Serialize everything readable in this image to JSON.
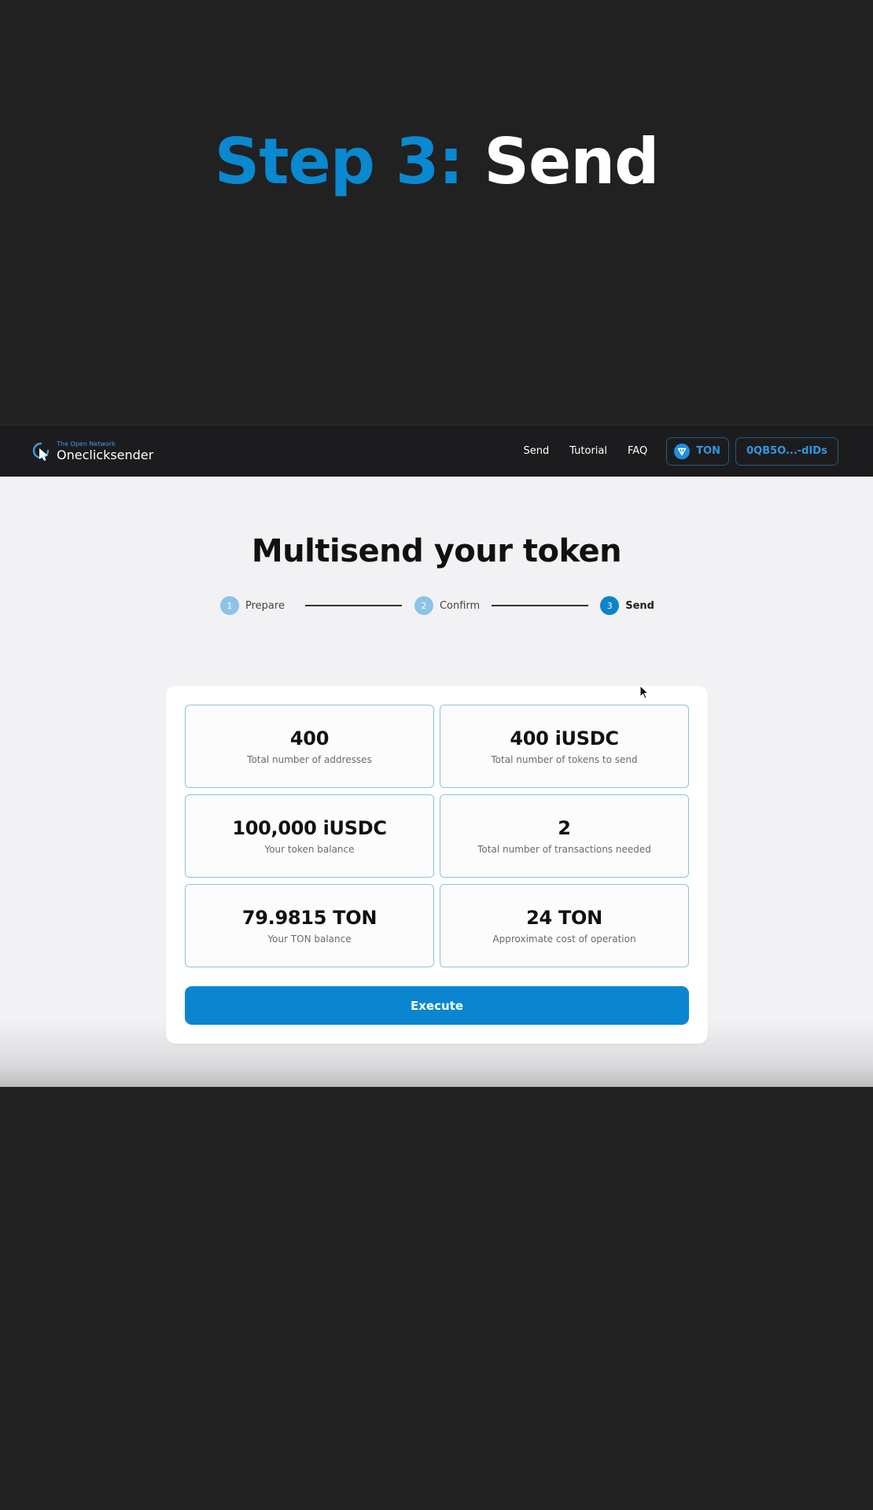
{
  "banner": {
    "step_prefix": "Step 3:",
    "step_name": "Send"
  },
  "navbar": {
    "logo_subtitle": "The Open Network",
    "logo_name": "Oneclicksender",
    "links": [
      "Send",
      "Tutorial",
      "FAQ"
    ],
    "network_label": "TON",
    "wallet_address": "0QB5O...-dIDs"
  },
  "page": {
    "title": "Multisend your token"
  },
  "stepper": {
    "steps": [
      {
        "number": "1",
        "label": "Prepare"
      },
      {
        "number": "2",
        "label": "Confirm"
      },
      {
        "number": "3",
        "label": "Send"
      }
    ],
    "active_step": 3
  },
  "stats": [
    {
      "value": "400",
      "label": "Total number of addresses"
    },
    {
      "value": "400 iUSDC",
      "label": "Total number of tokens to send"
    },
    {
      "value": "100,000 iUSDC",
      "label": "Your token balance"
    },
    {
      "value": "2",
      "label": "Total number of transactions needed"
    },
    {
      "value": "79.9815 TON",
      "label": "Your TON balance"
    },
    {
      "value": "24 TON",
      "label": "Approximate cost of operation"
    }
  ],
  "actions": {
    "execute_label": "Execute"
  },
  "colors": {
    "accent": "#0a86d0",
    "background_dark": "#212121",
    "navbar": "#1c1c1e",
    "card_border": "#8ec5d2"
  },
  "icons": {
    "logo": "cursor-click-logo-icon",
    "network": "ton-diamond-icon",
    "pointer": "mouse-pointer-icon"
  }
}
